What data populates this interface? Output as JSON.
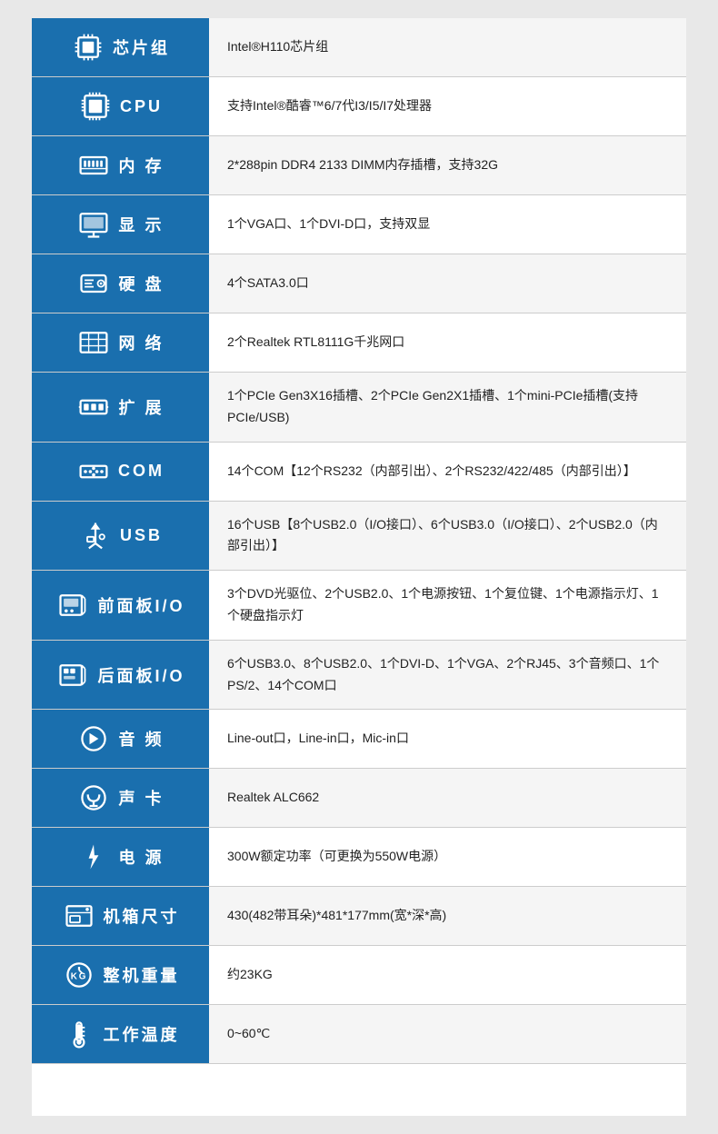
{
  "rows": [
    {
      "id": "chipset",
      "label": "芯片组",
      "value": "Intel®H110芯片组",
      "icon": "chipset"
    },
    {
      "id": "cpu",
      "label": "CPU",
      "value": "支持Intel®酷睿™6/7代I3/I5/I7处理器",
      "icon": "cpu"
    },
    {
      "id": "memory",
      "label": "内  存",
      "value": "2*288pin DDR4 2133 DIMM内存插槽，支持32G",
      "icon": "memory"
    },
    {
      "id": "display",
      "label": "显 示",
      "value": "1个VGA口、1个DVI-D口，支持双显",
      "icon": "display"
    },
    {
      "id": "harddisk",
      "label": "硬 盘",
      "value": "4个SATA3.0口",
      "icon": "harddisk"
    },
    {
      "id": "network",
      "label": "网 络",
      "value": "2个Realtek RTL8111G千兆网口",
      "icon": "network"
    },
    {
      "id": "expansion",
      "label": "扩 展",
      "value": "1个PCIe Gen3X16插槽、2个PCIe Gen2X1插槽、1个mini-PCIe插槽(支持PCIe/USB)",
      "icon": "expansion"
    },
    {
      "id": "com",
      "label": "COM",
      "value": "14个COM【12个RS232（内部引出）、2个RS232/422/485（内部引出）】",
      "icon": "com"
    },
    {
      "id": "usb",
      "label": "USB",
      "value": "16个USB【8个USB2.0（I/O接口）、6个USB3.0（I/O接口）、2个USB2.0（内部引出）】",
      "icon": "usb"
    },
    {
      "id": "front-io",
      "label": "前面板I/O",
      "value": "3个DVD光驱位、2个USB2.0、1个电源按钮、1个复位键、1个电源指示灯、1个硬盘指示灯",
      "icon": "front-panel"
    },
    {
      "id": "rear-io",
      "label": "后面板I/O",
      "value": "6个USB3.0、8个USB2.0、1个DVI-D、1个VGA、2个RJ45、3个音频口、1个PS/2、14个COM口",
      "icon": "rear-panel"
    },
    {
      "id": "audio",
      "label": "音 频",
      "value": "Line-out口，Line-in口，Mic-in口",
      "icon": "audio"
    },
    {
      "id": "soundcard",
      "label": "声 卡",
      "value": "Realtek ALC662",
      "icon": "soundcard"
    },
    {
      "id": "power",
      "label": "电  源",
      "value": "300W额定功率（可更换为550W电源）",
      "icon": "power"
    },
    {
      "id": "chassis",
      "label": "机箱尺寸",
      "value": "430(482带耳朵)*481*177mm(宽*深*高)",
      "icon": "chassis"
    },
    {
      "id": "weight",
      "label": "整机重量",
      "value": "约23KG",
      "icon": "weight"
    },
    {
      "id": "temperature",
      "label": "工作温度",
      "value": "0~60℃",
      "icon": "temperature"
    }
  ]
}
